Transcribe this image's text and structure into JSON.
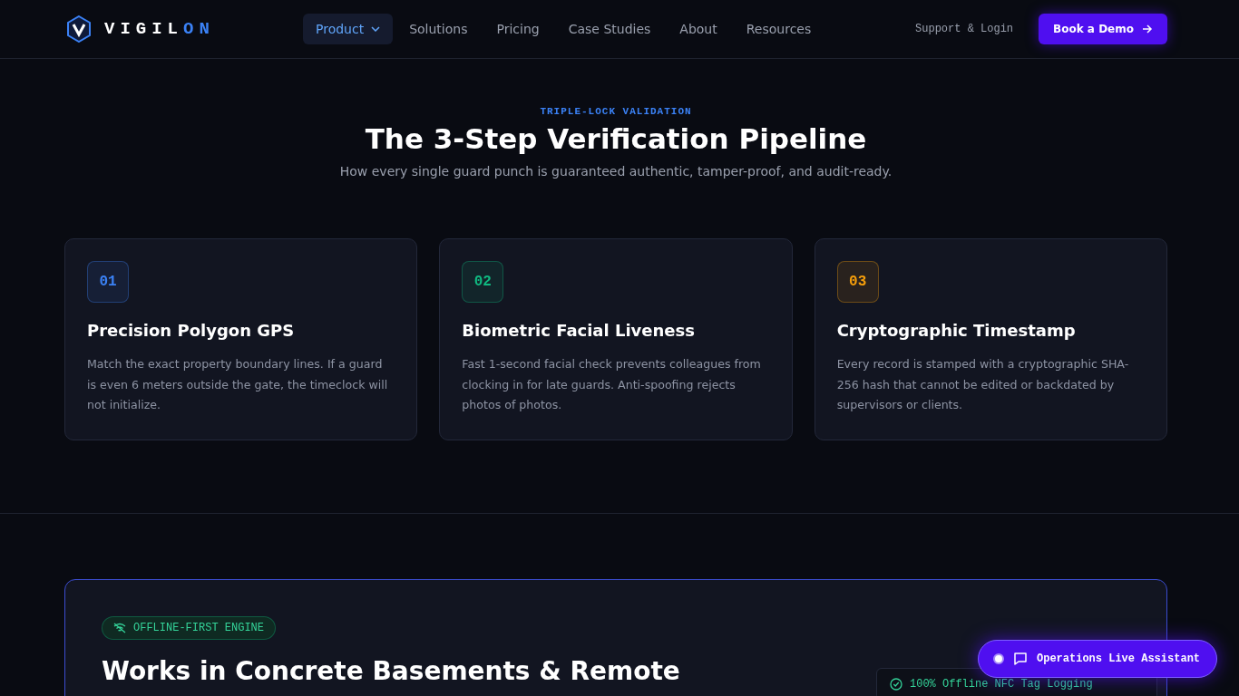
{
  "brand": {
    "name_start": "VIGIL",
    "name_end": "ON"
  },
  "nav": [
    {
      "label": "Product",
      "selected": true,
      "dropdown": true
    },
    {
      "label": "Solutions",
      "selected": false
    },
    {
      "label": "Pricing",
      "selected": false
    },
    {
      "label": "Case Studies",
      "selected": false
    },
    {
      "label": "About",
      "selected": false
    },
    {
      "label": "Resources",
      "selected": false
    }
  ],
  "support_link": "Support & Login",
  "cta": "Book a Demo",
  "section": {
    "eyebrow": "TRIPLE-LOCK VALIDATION",
    "title": "The 3-Step Verification Pipeline",
    "subtitle": "How every single guard punch is guaranteed authentic, tamper-proof, and audit-ready."
  },
  "steps": [
    {
      "number": "01",
      "color": "#3b82f6",
      "title": "Precision Polygon GPS",
      "text": "Match the exact property boundary lines. If a guard is even 6 meters outside the gate, the timeclock will not initialize."
    },
    {
      "number": "02",
      "color": "#10b981",
      "title": "Biometric Facial Liveness",
      "text": "Fast 1-second facial check prevents colleagues from clocking in for late guards. Anti-spoofing rejects photos of photos."
    },
    {
      "number": "03",
      "color": "#f59e0b",
      "title": "Cryptographic Timestamp",
      "text": "Every record is stamped with a cryptographic SHA-256 hash that cannot be edited or backdated by supervisors or clients."
    }
  ],
  "offline": {
    "badge": "OFFLINE-FIRST ENGINE",
    "title": "Works in Concrete Basements & Remote",
    "feature": "100% Offline NFC Tag Logging"
  },
  "assistant": {
    "label": "Operations Live Assistant"
  }
}
